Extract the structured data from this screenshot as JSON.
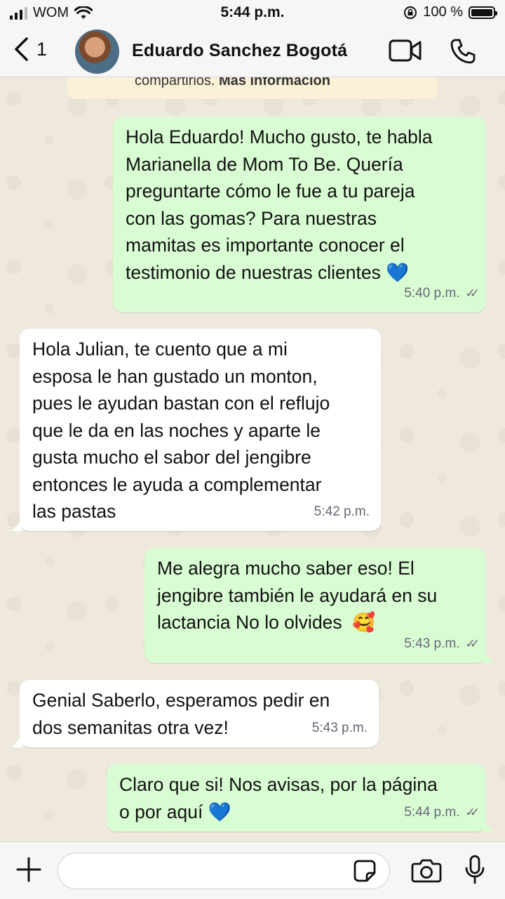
{
  "status_bar": {
    "carrier": "WOM",
    "time": "5:44 p.m.",
    "battery": "100 %"
  },
  "header": {
    "back_count": "1",
    "contact_name": "Eduardo Sanchez Bogotá"
  },
  "notice": {
    "text": "compartirlos. ",
    "link": "Más información"
  },
  "messages": [
    {
      "direction": "out",
      "lines": [
        "Hola Eduardo! Mucho gusto, te habla",
        "Marianella de Mom To Be. Quería",
        "preguntarte cómo le fue a tu pareja",
        "con las gomas? Para nuestras",
        "mamitas es importante conocer el",
        "testimonio de nuestras clientes 💙"
      ],
      "time": "5:40 p.m."
    },
    {
      "direction": "in",
      "lines": [
        "Hola Julian, te cuento que a mi",
        "esposa le han gustado un monton,",
        "pues le ayudan bastan con el reflujo",
        "que le da en las noches y aparte le",
        "gusta mucho el sabor del jengibre",
        "entonces le ayuda a complementar",
        "las pastas"
      ],
      "time": "5:42 p.m."
    },
    {
      "direction": "out",
      "lines": [
        "Me alegra mucho saber eso! El",
        "jengibre también le ayudará en su",
        "lactancia No lo olvides  🥰"
      ],
      "time": "5:43 p.m."
    },
    {
      "direction": "in",
      "lines": [
        "Genial Saberlo, esperamos pedir en",
        "dos semanitas otra vez!"
      ],
      "time": "5:43 p.m."
    },
    {
      "direction": "out",
      "lines": [
        "Claro que si! Nos avisas, por la página",
        "o por aquí 💙"
      ],
      "time": "5:44 p.m."
    }
  ],
  "input": {
    "placeholder": ""
  },
  "icons": {
    "back": "chevron-left-icon",
    "video": "video-camera-icon",
    "call": "phone-icon",
    "plus": "plus-icon",
    "sticker": "sticker-icon",
    "camera": "camera-icon",
    "mic": "microphone-icon"
  },
  "colors": {
    "outgoing_bubble": "#d9fdd3",
    "incoming_bubble": "#ffffff",
    "wallpaper": "#efe8dc"
  }
}
